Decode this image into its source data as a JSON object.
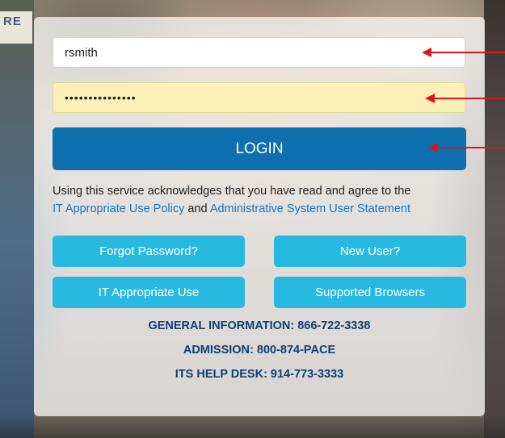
{
  "background": {
    "sign_text": "RE"
  },
  "form": {
    "username_value": "rsmith",
    "password_mask": "•••••••••••••••",
    "login_label": "LOGIN"
  },
  "acknowledgement": {
    "text_before": "Using this service acknowledges that you have read and agree to the",
    "policy_link": "IT Appropriate Use Policy",
    "conjunction": "and",
    "statement_link": "Administrative System User Statement"
  },
  "buttons": {
    "forgot_password": "Forgot Password?",
    "new_user": "New User?",
    "it_appropriate_use": "IT Appropriate Use",
    "supported_browsers": "Supported Browsers"
  },
  "contact": {
    "general_info": "GENERAL INFORMATION: 866-722-3338",
    "admission": "ADMISSION: 800-874-PACE",
    "help_desk": "ITS HELP DESK: 914-773-3333"
  },
  "colors": {
    "login_button": "#0d6fae",
    "secondary_button": "#27b9e0",
    "link": "#1177c4",
    "contact_text": "#0d3f7a",
    "annotation_arrow": "#e2141b",
    "password_autofill": "#fbf0b8"
  }
}
